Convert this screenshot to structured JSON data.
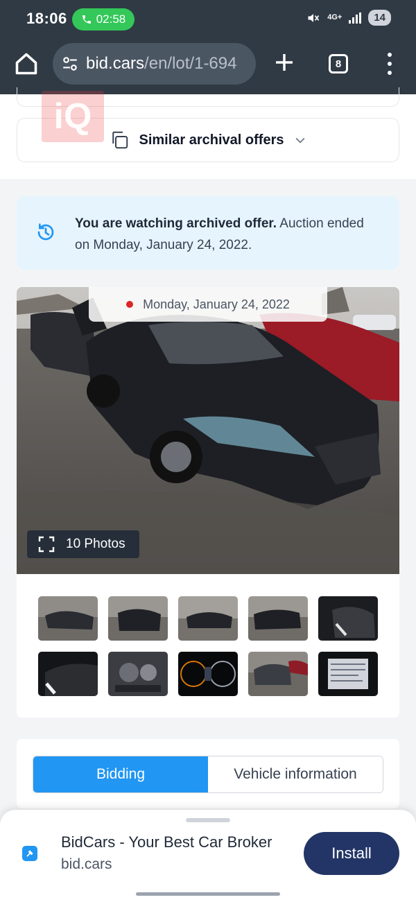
{
  "status_bar": {
    "time": "18:06",
    "call_duration": "02:58",
    "network": "4G+",
    "battery": "14"
  },
  "browser": {
    "url_domain": "bid.cars",
    "url_path": "/en/lot/1-694",
    "tab_count": "8",
    "icons": [
      "home-icon",
      "site-settings-icon",
      "plus-icon",
      "tabs-icon",
      "more-vert-icon"
    ]
  },
  "page": {
    "similar_offers": "Similar archival offers",
    "watermark": "iQ",
    "archived_notice": {
      "bold": "You are watching archived offer.",
      "rest": " Auction ended on Monday, January 24, 2022."
    },
    "photo_date": "Monday, January 24, 2022",
    "photos_count_label": "10 Photos",
    "tabs": [
      {
        "label": "Bidding",
        "active": true
      },
      {
        "label": "Vehicle information",
        "active": false
      }
    ]
  },
  "install_banner": {
    "title": "BidCars - Your Best Car Broker",
    "subtitle": "bid.cars",
    "button": "Install"
  },
  "colors": {
    "chrome": "#2f3a44",
    "accent": "#2196f3",
    "install": "#223566",
    "notice_bg": "#e6f4fd"
  }
}
